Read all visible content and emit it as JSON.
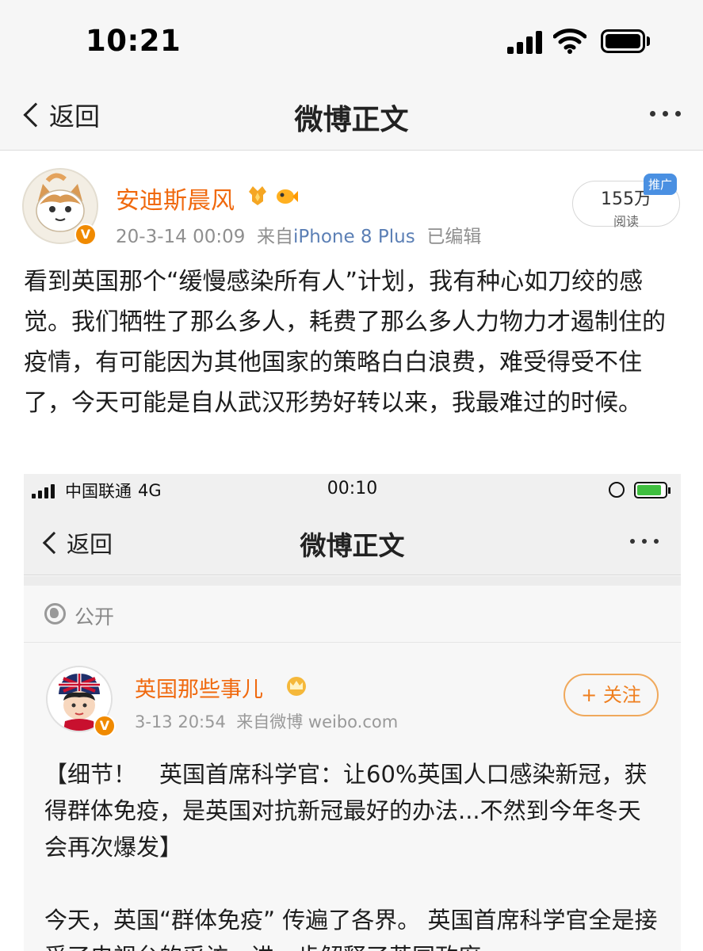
{
  "status_bar": {
    "time": "10:21"
  },
  "nav": {
    "back_label": "返回",
    "title": "微博正文"
  },
  "post": {
    "author": "安迪斯晨风",
    "date": "20-3-14 00:09",
    "source_prefix": "来自",
    "source": "iPhone 8 Plus",
    "edited": "已编辑",
    "read_count": "155万",
    "read_label": "阅读",
    "promo_tag": "推广",
    "verified_badge": "V",
    "text": "看到英国那个“缓慢感染所有人”计划，我有种心如刀绞的感觉。我们牺牲了那么多人，耗费了那么多人力物力才遏制住的疫情，有可能因为其他国家的策略白白浪费，难受得受不住了，今天可能是自从武汉形势好转以来，我最难过的时候。"
  },
  "embedded": {
    "carrier": "中国联通",
    "network": "4G",
    "time": "00:10",
    "back_label": "返回",
    "title": "微博正文",
    "visibility": "公开",
    "author": "英国那些事儿",
    "date": "3-13 20:54",
    "source_prefix": "来自微博",
    "source": "weibo.com",
    "follow_label": "+ 关注",
    "verified_badge": "V",
    "text": "【细节！　英国首席科学官：让60%英国人口感染新冠，获得群体免疫，是英国对抗新冠最好的办法...不然到今年冬天会再次爆发】",
    "text2": "今天，英国“群体免疫” 传遍了各界。 英国首席科学官全是接受了电视台的采访，进一步解释了英国政府"
  },
  "colors": {
    "author": "#f0690e",
    "link": "#5b7fb5",
    "follow": "#ef7f1f",
    "promo": "#4a90e2"
  },
  "icons": [
    "back-chevron-icon",
    "more-dots-icon",
    "signal-icon",
    "wifi-icon",
    "battery-icon",
    "verified-badge-icon",
    "medal-icon",
    "fish-icon",
    "globe-icon",
    "crown-icon"
  ]
}
